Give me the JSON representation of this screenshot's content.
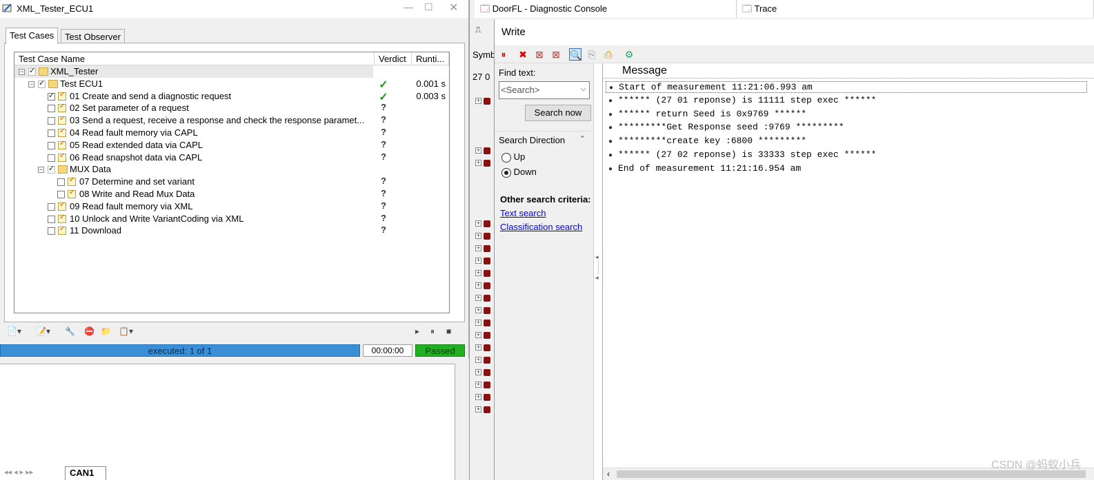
{
  "left_window": {
    "title": "XML_Tester_ECU1",
    "tabs": [
      "Test Cases",
      "Test Observer"
    ],
    "columns": [
      "Test Case Name",
      "Verdict",
      "Runti..."
    ],
    "rows": [
      {
        "label": "XML_Tester",
        "indent": 0,
        "type": "root",
        "verdict": "",
        "runtime": ""
      },
      {
        "label": "Test ECU1",
        "indent": 1,
        "type": "group",
        "verdict": "",
        "runtime": ""
      },
      {
        "label": "01 Create and send a diagnostic request",
        "indent": 2,
        "type": "case",
        "checked": true,
        "verdict": "✓",
        "runtime": "0.003 s"
      },
      {
        "label": "02 Set parameter of a request",
        "indent": 2,
        "type": "case",
        "verdict": "?",
        "runtime": ""
      },
      {
        "label": "03 Send a request, receive a response and check the response paramet...",
        "indent": 2,
        "type": "case",
        "verdict": "?",
        "runtime": ""
      },
      {
        "label": "04 Read fault memory via CAPL",
        "indent": 2,
        "type": "case",
        "verdict": "?",
        "runtime": ""
      },
      {
        "label": "05 Read extended data via CAPL",
        "indent": 2,
        "type": "case",
        "verdict": "?",
        "runtime": ""
      },
      {
        "label": "06 Read snapshot data via CAPL",
        "indent": 2,
        "type": "case",
        "verdict": "?",
        "runtime": ""
      },
      {
        "label": "MUX Data",
        "indent": 2,
        "type": "group",
        "verdict": "",
        "runtime": ""
      },
      {
        "label": "07 Determine and set variant",
        "indent": 3,
        "type": "case",
        "verdict": "?",
        "runtime": ""
      },
      {
        "label": "08 Write and Read Mux Data",
        "indent": 3,
        "type": "case",
        "verdict": "?",
        "runtime": ""
      },
      {
        "label": "09 Read fault memory via XML",
        "indent": 2,
        "type": "case",
        "verdict": "?",
        "runtime": ""
      },
      {
        "label": "10 Unlock and Write VariantCoding via XML",
        "indent": 2,
        "type": "case",
        "verdict": "?",
        "runtime": ""
      },
      {
        "label": "11 Download",
        "indent": 2,
        "type": "case",
        "verdict": "?",
        "runtime": ""
      }
    ],
    "row_runtime_fix": {
      "1": "0.001 s"
    },
    "progress_text": "executed: 1 of 1",
    "elapsed": "00:00:00",
    "status": "Passed"
  },
  "lower_left": {
    "tab": "CAN1"
  },
  "top_tabs": {
    "console": "DoorFL - Diagnostic Console",
    "trace": "Trace"
  },
  "mid_strip": {
    "symbol_fragment": "Symb",
    "value_fragment": "27 0"
  },
  "write_window": {
    "title": "Write",
    "find_text_label": "Find text:",
    "search_placeholder": "<Search>",
    "search_button": "Search now",
    "search_direction_label": "Search Direction",
    "direction_options": [
      "Up",
      "Down"
    ],
    "direction_selected": "Down",
    "other_criteria_label": "Other search criteria:",
    "links": [
      "Text search",
      "Classification search"
    ],
    "message_header": "Message",
    "messages": [
      "Start of measurement 11:21:06.993 am",
      "****** (27 01 reponse) is 11111 step exec ******",
      "****** return Seed is 0x9769 ******",
      "*********Get Response seed :9769 *********",
      "*********create key :6800 *********",
      "****** (27 02 reponse) is 33333 step exec ******",
      "End of measurement 11:21:16.954 am"
    ]
  },
  "watermark": "CSDN @蚂蚁小兵"
}
